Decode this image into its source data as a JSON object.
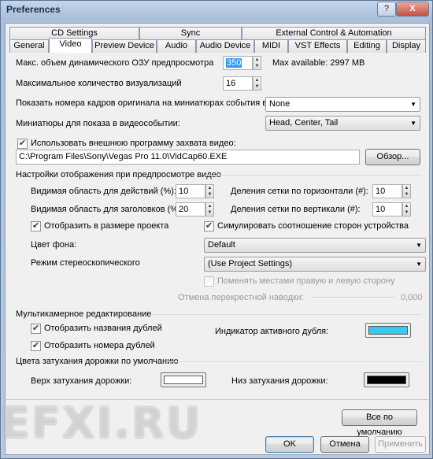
{
  "window": {
    "title": "Preferences",
    "help_label": "?",
    "close_label": "X"
  },
  "tabs_row1": [
    "CD Settings",
    "Sync",
    "External Control & Automation"
  ],
  "tabs_row2": [
    "General",
    "Video",
    "Preview Device",
    "Audio",
    "Audio Device",
    "MIDI",
    "VST Effects",
    "Editing",
    "Display"
  ],
  "active_tab": "Video",
  "video": {
    "max_ram_label": "Макс. объем динамического ОЗУ предпросмотра",
    "max_ram_value": "350",
    "max_available": "Max available: 2997 MB",
    "max_thumbs_label": "Максимальное количество визуализаций",
    "max_thumbs_value": "16",
    "frame_numbers_label": "Показать номера кадров оригинала на миниатюрах события в виде:",
    "frame_numbers_value": "None",
    "thumbs_event_label": "Миниатюры для показа в видеособытии:",
    "thumbs_event_value": "Head, Center, Tail",
    "ext_capture_label": "Использовать внешнюю программу захвата видео:",
    "ext_capture_checked": true,
    "ext_capture_path": "C:\\Program Files\\Sony\\Vegas Pro 11.0\\VidCap60.EXE",
    "browse_label": "Обзор..."
  },
  "preview_display": {
    "section_label": "Настройки отображения при предпросмотре видео",
    "action_safe_label": "Видимая область для действий (%):",
    "action_safe_value": "10",
    "title_safe_label": "Видимая область для заголовков (%):",
    "title_safe_value": "20",
    "hgrid_label": "Деления сетки по горизонтали (#):",
    "hgrid_value": "10",
    "vgrid_label": "Деления сетки по вертикали (#):",
    "vgrid_value": "10",
    "project_size_label": "Отобразить в размере проекта",
    "project_size_checked": true,
    "simulate_aspect_label": "Симулировать соотношение сторон устройства",
    "simulate_aspect_checked": true,
    "bg_color_label": "Цвет фона:",
    "bg_color_value": "Default",
    "stereo_mode_label": "Режим стереоскопического",
    "stereo_mode_value": "(Use Project Settings)",
    "swap_label": "Поменять местами правую и левую сторону",
    "swap_checked": false,
    "crosstalk_label": "Отмена перекрестной наводки:",
    "crosstalk_value": "0,000"
  },
  "multicam": {
    "section_label": "Мультикамерное редактирование",
    "show_take_names_label": "Отобразить названия дублей",
    "show_take_names_checked": true,
    "show_take_numbers_label": "Отобразить номера дублей",
    "show_take_numbers_checked": true,
    "active_take_label": "Индикатор активного дубля:",
    "active_take_color": "#33ccee"
  },
  "fade": {
    "section_label": "Цвета затухания дорожки по умолчанию",
    "top_label": "Верх затухания дорожки:",
    "top_color": "#ffffff",
    "bottom_label": "Низ затухания дорожки:",
    "bottom_color": "#000000"
  },
  "buttons": {
    "defaults": "Все по умолчанию",
    "ok": "OK",
    "cancel": "Отмена",
    "apply": "Применить"
  },
  "watermark": "EFXI.RU"
}
